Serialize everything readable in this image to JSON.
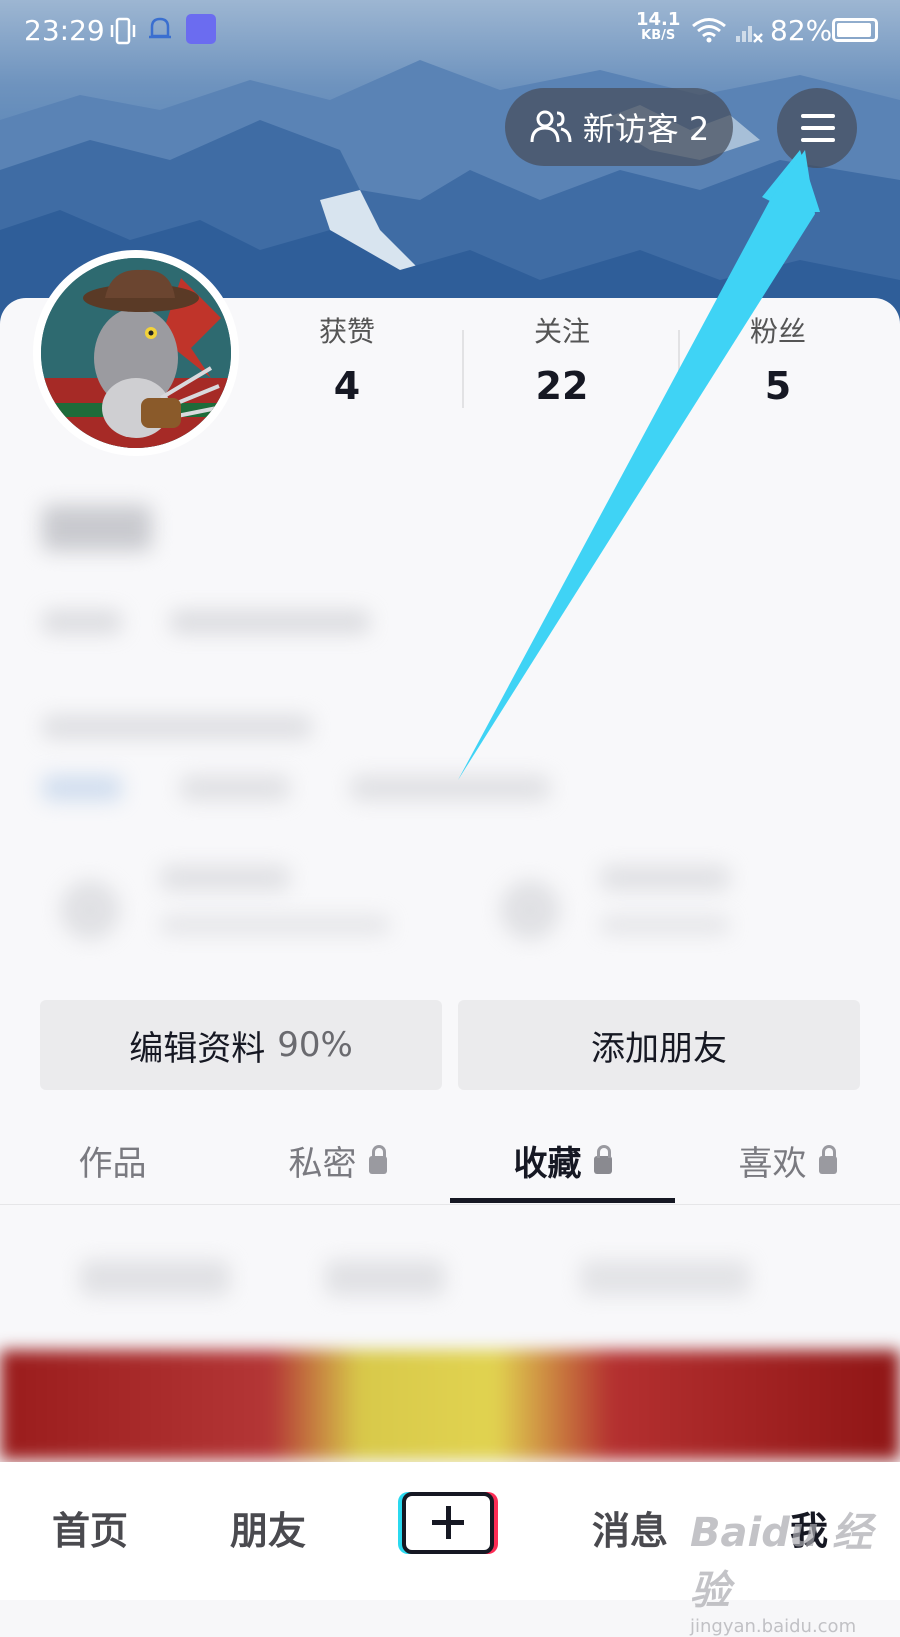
{
  "status_bar": {
    "time": "23:29",
    "speed_value": "14.1",
    "speed_unit": "KB/S",
    "battery": "82%"
  },
  "header": {
    "visitor_label": "新访客 2"
  },
  "stats": [
    {
      "label": "获赞",
      "value": "4"
    },
    {
      "label": "关注",
      "value": "22"
    },
    {
      "label": "粉丝",
      "value": "5"
    }
  ],
  "actions": {
    "edit_profile": "编辑资料",
    "edit_profile_pct": "90%",
    "add_friends": "添加朋友"
  },
  "tabs": [
    {
      "label": "作品",
      "locked": false
    },
    {
      "label": "私密",
      "locked": true
    },
    {
      "label": "收藏",
      "locked": true,
      "active": true
    },
    {
      "label": "喜欢",
      "locked": true
    }
  ],
  "bottom_nav": {
    "home": "首页",
    "friends": "朋友",
    "messages": "消息",
    "me": "我"
  },
  "watermark": {
    "brand": "Baidu 经验",
    "url": "jingyan.baidu.com"
  },
  "colors": {
    "accent_cyan": "#3fd3f5",
    "text_primary": "#161823"
  }
}
